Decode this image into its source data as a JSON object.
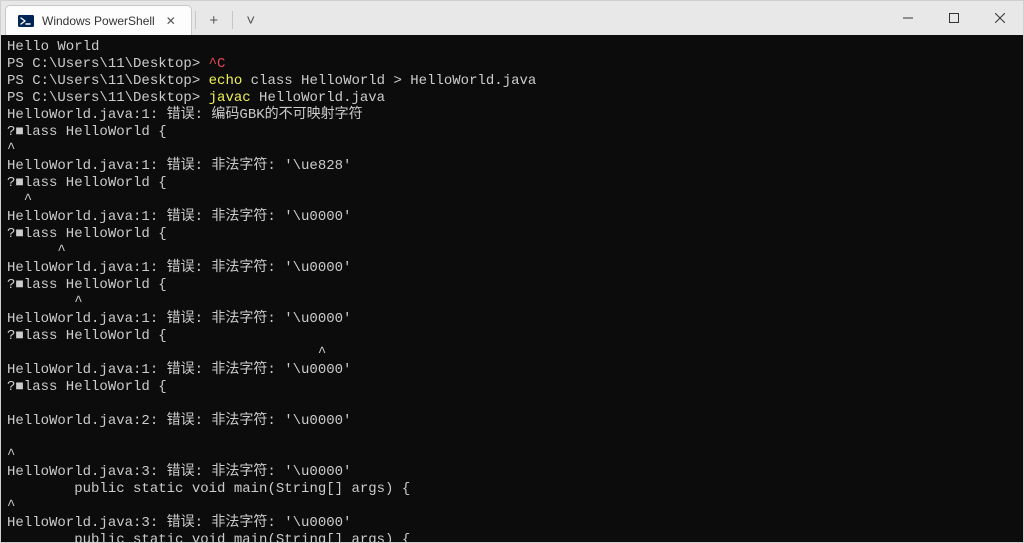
{
  "window": {
    "tab_title": "Windows PowerShell",
    "minimize_glyph": "—",
    "maximize_glyph": "☐",
    "close_glyph": "✕",
    "tab_close_glyph": "✕",
    "add_tab_glyph": "+",
    "dropdown_glyph": "˅"
  },
  "terminal": {
    "lines": [
      {
        "segments": [
          {
            "text": "Hello World"
          }
        ]
      },
      {
        "segments": [
          {
            "text": "PS C:\\Users\\11\\Desktop> "
          },
          {
            "text": "^C",
            "class": "red"
          }
        ]
      },
      {
        "segments": [
          {
            "text": "PS C:\\Users\\11\\Desktop> "
          },
          {
            "text": "echo",
            "class": "yellow"
          },
          {
            "text": " class HelloWorld > HelloWorld.java"
          }
        ]
      },
      {
        "segments": [
          {
            "text": "PS C:\\Users\\11\\Desktop> "
          },
          {
            "text": "javac",
            "class": "yellow"
          },
          {
            "text": " HelloWorld.java"
          }
        ]
      },
      {
        "segments": [
          {
            "text": "HelloWorld.java:1: 错误: 编码GBK的不可映射字符"
          }
        ]
      },
      {
        "segments": [
          {
            "text": "?■lass HelloWorld {"
          }
        ]
      },
      {
        "segments": [
          {
            "text": "^"
          }
        ]
      },
      {
        "segments": [
          {
            "text": "HelloWorld.java:1: 错误: 非法字符: '\\ue828'"
          }
        ]
      },
      {
        "segments": [
          {
            "text": "?■lass HelloWorld {"
          }
        ]
      },
      {
        "segments": [
          {
            "text": "  ^"
          }
        ]
      },
      {
        "segments": [
          {
            "text": "HelloWorld.java:1: 错误: 非法字符: '\\u0000'"
          }
        ]
      },
      {
        "segments": [
          {
            "text": "?■lass HelloWorld {"
          }
        ]
      },
      {
        "segments": [
          {
            "text": "      ^"
          }
        ]
      },
      {
        "segments": [
          {
            "text": "HelloWorld.java:1: 错误: 非法字符: '\\u0000'"
          }
        ]
      },
      {
        "segments": [
          {
            "text": "?■lass HelloWorld {"
          }
        ]
      },
      {
        "segments": [
          {
            "text": "        ^"
          }
        ]
      },
      {
        "segments": [
          {
            "text": "HelloWorld.java:1: 错误: 非法字符: '\\u0000'"
          }
        ]
      },
      {
        "segments": [
          {
            "text": "?■lass HelloWorld {"
          }
        ]
      },
      {
        "segments": [
          {
            "text": "                                     ^"
          }
        ]
      },
      {
        "segments": [
          {
            "text": "HelloWorld.java:1: 错误: 非法字符: '\\u0000'"
          }
        ]
      },
      {
        "segments": [
          {
            "text": "?■lass HelloWorld {"
          }
        ]
      },
      {
        "segments": [
          {
            "text": ""
          }
        ]
      },
      {
        "segments": [
          {
            "text": "HelloWorld.java:2: 错误: 非法字符: '\\u0000'"
          }
        ]
      },
      {
        "segments": [
          {
            "text": ""
          }
        ]
      },
      {
        "segments": [
          {
            "text": "^"
          }
        ]
      },
      {
        "segments": [
          {
            "text": "HelloWorld.java:3: 错误: 非法字符: '\\u0000'"
          }
        ]
      },
      {
        "segments": [
          {
            "text": "        public static void main(String[] args) {"
          }
        ]
      },
      {
        "segments": [
          {
            "text": "^"
          }
        ]
      },
      {
        "segments": [
          {
            "text": "HelloWorld.java:3: 错误: 非法字符: '\\u0000'"
          }
        ]
      },
      {
        "segments": [
          {
            "text": "        public static void main(String[] args) {"
          }
        ]
      }
    ]
  }
}
